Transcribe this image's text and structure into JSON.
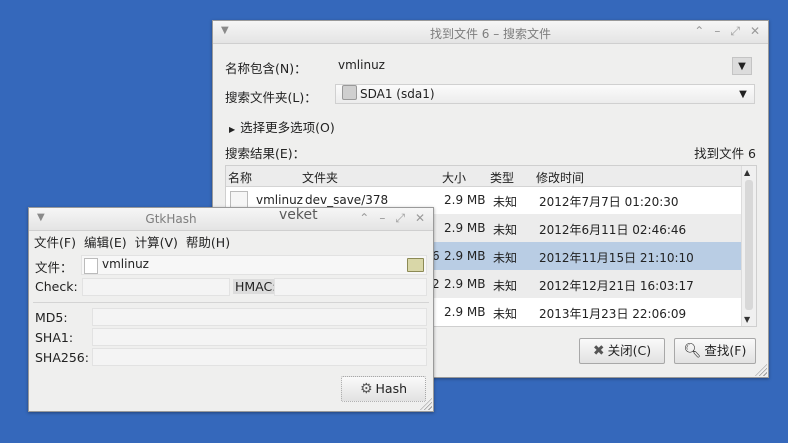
{
  "search_window": {
    "title": "找到文件 6 – 搜索文件",
    "name_label": "名称包含(N)：",
    "name_value": "vmlinuz",
    "folder_label": "搜索文件夹(L)：",
    "folder_value": "SDA1 (sda1)",
    "more_options": "选择更多选项(O)",
    "results_label": "搜索结果(E)：",
    "found_label": "找到文件 6",
    "columns": {
      "name": "名称",
      "folder": "文件夹",
      "size": "大小",
      "type": "类型",
      "mtime": "修改时间"
    },
    "rows": [
      {
        "name": "vmlinuz",
        "folder": "dev_save/378",
        "size": "2.9 MB",
        "type": "未知",
        "mtime": "2012年7月7日 01:20:30"
      },
      {
        "size": "2.9 MB",
        "type": "未知",
        "mtime": "2012年6月11日 02:46:46"
      },
      {
        "folder_tail": "6",
        "size": "2.9 MB",
        "type": "未知",
        "mtime": "2012年11月15日 21:10:10"
      },
      {
        "folder_tail": "2",
        "size": "2.9 MB",
        "type": "未知",
        "mtime": "2012年12月21日 16:03:17"
      },
      {
        "size": "2.9 MB",
        "type": "未知",
        "mtime": "2013年1月23日 22:06:09"
      }
    ],
    "close_button": "关闭(C)",
    "find_button": "查找(F)"
  },
  "hash_window": {
    "title": "GtkHash",
    "menu": [
      "文件(F)",
      "编辑(E)",
      "计算(V)",
      "帮助(H)"
    ],
    "file_label": "文件：",
    "file_value": "vmlinuz",
    "check_label": "Check:",
    "hmac_label": "HMAC:",
    "md5_label": "MD5:",
    "sha1_label": "SHA1:",
    "sha256_label": "SHA256:",
    "hash_button": "Hash"
  },
  "desktop": {
    "watermark": "veket"
  },
  "colors": {
    "desktop": "#3568bb",
    "selection": "#b9cde4"
  }
}
